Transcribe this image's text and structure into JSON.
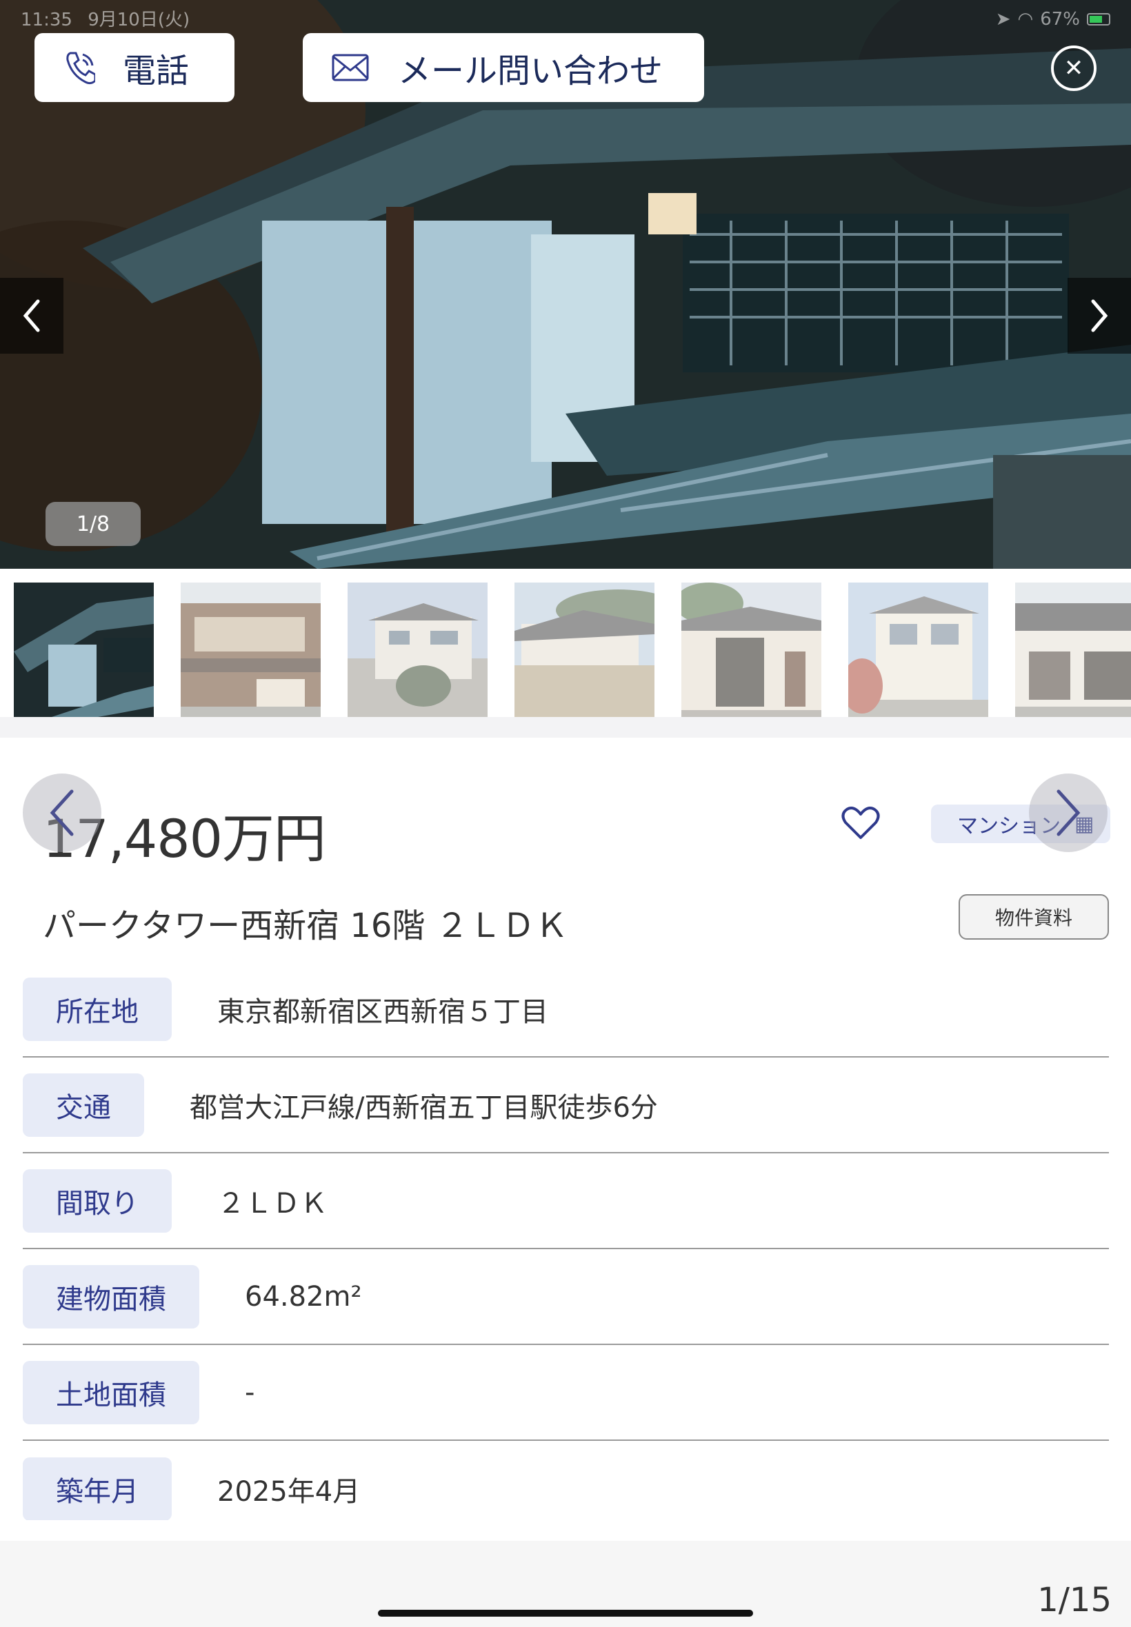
{
  "status_bar": {
    "time": "11:35",
    "date": "9月10日(火)",
    "battery": "67%"
  },
  "actions": {
    "call_label": "電話",
    "mail_label": "メール問い合わせ"
  },
  "gallery": {
    "counter": "1/8",
    "thumbnail_count": 7
  },
  "property": {
    "price": "17,480万円",
    "type_tag": "マンション",
    "title": "パークタワー西新宿 16階 ２ＬＤＫ",
    "doc_button": "物件資料"
  },
  "details": [
    {
      "label": "所在地",
      "value": "東京都新宿区西新宿５丁目"
    },
    {
      "label": "交通",
      "value": "都営大江戸線/西新宿五丁目駅徒歩6分"
    },
    {
      "label": "間取り",
      "value": "２ＬＤＫ"
    },
    {
      "label": "建物面積",
      "value": "64.82m²"
    },
    {
      "label": "土地面積",
      "value": "-"
    },
    {
      "label": "築年月",
      "value": "2025年4月"
    }
  ],
  "footer": {
    "page_counter": "1/15"
  },
  "colors": {
    "accent": "#2f3a8c",
    "label_bg": "#e7ebf7",
    "divider": "#9a9a9a"
  }
}
